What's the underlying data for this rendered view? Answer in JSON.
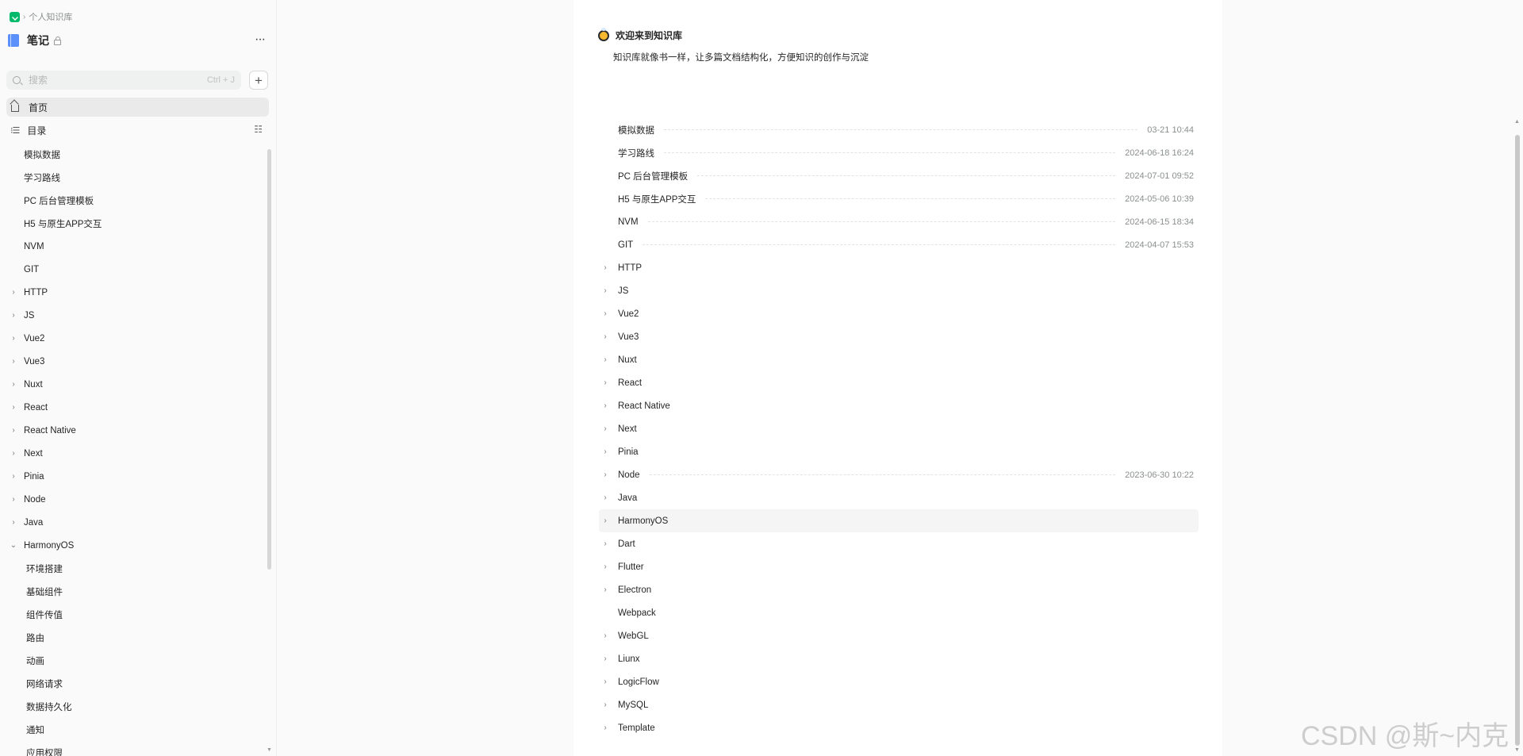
{
  "breadcrumb": {
    "parent": "个人知识库"
  },
  "book": {
    "title": "笔记"
  },
  "search": {
    "placeholder": "搜索",
    "shortcut": "Ctrl + J"
  },
  "nav": {
    "home": "首页",
    "toc": "目录"
  },
  "sidebar_tree": [
    {
      "label": "模拟数据",
      "caret": "",
      "child": false
    },
    {
      "label": "学习路线",
      "caret": "",
      "child": false
    },
    {
      "label": "PC 后台管理模板",
      "caret": "",
      "child": false
    },
    {
      "label": "H5 与原生APP交互",
      "caret": "",
      "child": false
    },
    {
      "label": "NVM",
      "caret": "",
      "child": false
    },
    {
      "label": "GIT",
      "caret": "",
      "child": false
    },
    {
      "label": "HTTP",
      "caret": "›",
      "child": false
    },
    {
      "label": "JS",
      "caret": "›",
      "child": false
    },
    {
      "label": "Vue2",
      "caret": "›",
      "child": false
    },
    {
      "label": "Vue3",
      "caret": "›",
      "child": false
    },
    {
      "label": "Nuxt",
      "caret": "›",
      "child": false
    },
    {
      "label": "React",
      "caret": "›",
      "child": false
    },
    {
      "label": "React Native",
      "caret": "›",
      "child": false
    },
    {
      "label": "Next",
      "caret": "›",
      "child": false
    },
    {
      "label": "Pinia",
      "caret": "›",
      "child": false
    },
    {
      "label": "Node",
      "caret": "›",
      "child": false
    },
    {
      "label": "Java",
      "caret": "›",
      "child": false
    },
    {
      "label": "HarmonyOS",
      "caret": "⌄",
      "child": false
    },
    {
      "label": "环境搭建",
      "caret": "",
      "child": true
    },
    {
      "label": "基础组件",
      "caret": "",
      "child": true
    },
    {
      "label": "组件传值",
      "caret": "",
      "child": true
    },
    {
      "label": "路由",
      "caret": "",
      "child": true
    },
    {
      "label": "动画",
      "caret": "",
      "child": true
    },
    {
      "label": "网络请求",
      "caret": "",
      "child": true
    },
    {
      "label": "数据持久化",
      "caret": "",
      "child": true
    },
    {
      "label": "通知",
      "caret": "",
      "child": true
    },
    {
      "label": "应用权限",
      "caret": "",
      "child": true
    }
  ],
  "welcome": {
    "title": "欢迎来到知识库",
    "subtitle": "知识库就像书一样，让多篇文档结构化，方便知识的创作与沉淀"
  },
  "doc_list": [
    {
      "title": "模拟数据",
      "date": "03-21 10:44",
      "caret": ""
    },
    {
      "title": "学习路线",
      "date": "2024-06-18 16:24",
      "caret": ""
    },
    {
      "title": "PC 后台管理模板",
      "date": "2024-07-01 09:52",
      "caret": ""
    },
    {
      "title": "H5 与原生APP交互",
      "date": "2024-05-06 10:39",
      "caret": ""
    },
    {
      "title": "NVM",
      "date": "2024-06-15 18:34",
      "caret": ""
    },
    {
      "title": "GIT",
      "date": "2024-04-07 15:53",
      "caret": ""
    },
    {
      "title": "HTTP",
      "date": "",
      "caret": "›"
    },
    {
      "title": "JS",
      "date": "",
      "caret": "›"
    },
    {
      "title": "Vue2",
      "date": "",
      "caret": "›"
    },
    {
      "title": "Vue3",
      "date": "",
      "caret": "›"
    },
    {
      "title": "Nuxt",
      "date": "",
      "caret": "›"
    },
    {
      "title": "React",
      "date": "",
      "caret": "›"
    },
    {
      "title": "React Native",
      "date": "",
      "caret": "›"
    },
    {
      "title": "Next",
      "date": "",
      "caret": "›"
    },
    {
      "title": "Pinia",
      "date": "",
      "caret": "›"
    },
    {
      "title": "Node",
      "date": "2023-06-30 10:22",
      "caret": "›"
    },
    {
      "title": "Java",
      "date": "",
      "caret": "›"
    },
    {
      "title": "HarmonyOS",
      "date": "",
      "caret": "›",
      "hover": true
    },
    {
      "title": "Dart",
      "date": "",
      "caret": "›"
    },
    {
      "title": "Flutter",
      "date": "",
      "caret": "›"
    },
    {
      "title": "Electron",
      "date": "",
      "caret": "›"
    },
    {
      "title": "Webpack",
      "date": "",
      "caret": ""
    },
    {
      "title": "WebGL",
      "date": "",
      "caret": "›"
    },
    {
      "title": "Liunx",
      "date": "",
      "caret": "›"
    },
    {
      "title": "LogicFlow",
      "date": "",
      "caret": "›"
    },
    {
      "title": "MySQL",
      "date": "",
      "caret": "›"
    },
    {
      "title": "Template",
      "date": "",
      "caret": "›"
    }
  ],
  "watermark": "CSDN @斯~内克"
}
